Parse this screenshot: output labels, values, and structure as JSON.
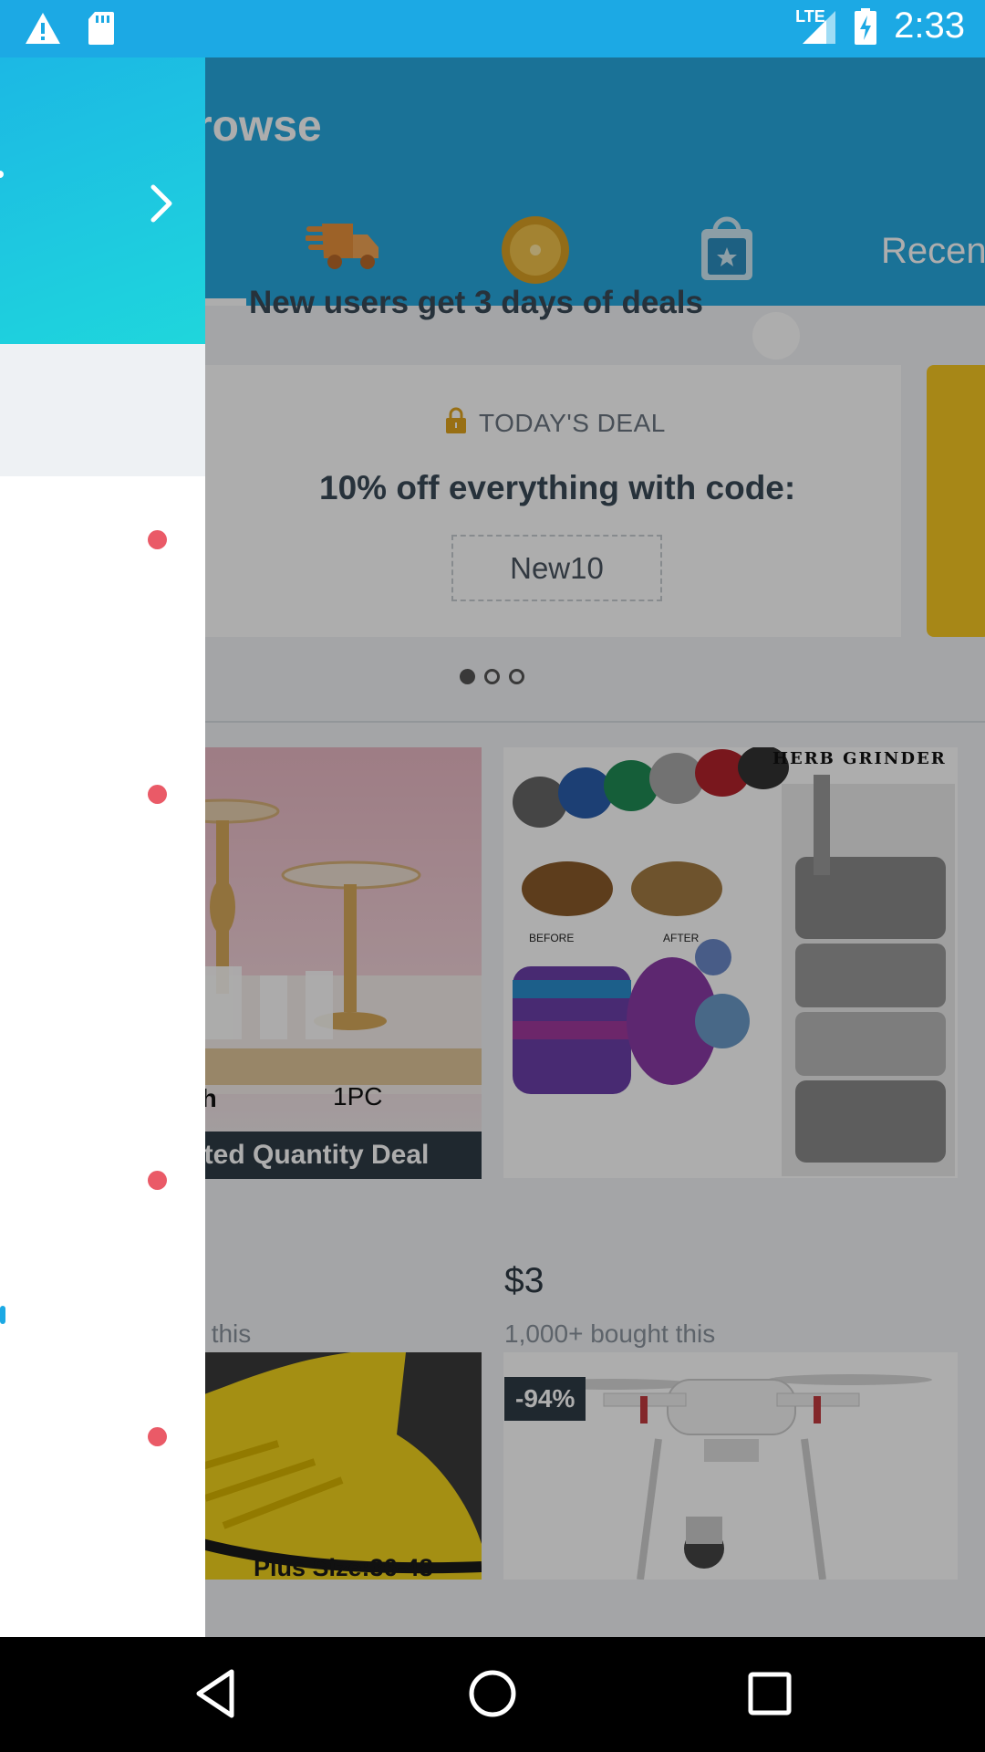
{
  "status_bar": {
    "time": "2:33",
    "network": "LTE",
    "icons": [
      "warning-icon",
      "sd-card-icon",
      "signal-icon",
      "battery-charging-icon"
    ]
  },
  "header": {
    "title": "rowse",
    "tabs": [
      {
        "icon": "delivery-truck-icon"
      },
      {
        "icon": "coin-icon"
      },
      {
        "icon": "shopping-bag-star-icon"
      },
      {
        "label": "Recen"
      }
    ]
  },
  "promo": {
    "text": "New users get 3 days of deals"
  },
  "deal": {
    "label": "TODAY'S DEAL",
    "headline": "10% off everything with code:",
    "code": "New10",
    "page_indicator_count": 3,
    "active_page": 1
  },
  "products": [
    {
      "caption_a": "nch",
      "caption_b": "1PC",
      "banner": "nited Quantity Deal",
      "price": ")",
      "bought": "ght this"
    },
    {
      "image_title": "HERB GRINDER",
      "image_labels": [
        "BEFORE",
        "AFTER"
      ],
      "price": "$3",
      "bought": "1,000+ bought this"
    },
    {
      "caption": "Plus Size:36-48"
    },
    {
      "badge": "-94%"
    }
  ],
  "drawer": {
    "notification_dots": 4
  },
  "colors": {
    "primary": "#1ca9e4",
    "drawer_gradient_start": "#1cb8e4",
    "drawer_gradient_end": "#1fd6dc",
    "notification": "#ea5a67",
    "deal_accent": "#f6c823"
  },
  "nav_bar": {
    "icons": [
      "back-icon",
      "home-icon",
      "recents-icon"
    ]
  }
}
